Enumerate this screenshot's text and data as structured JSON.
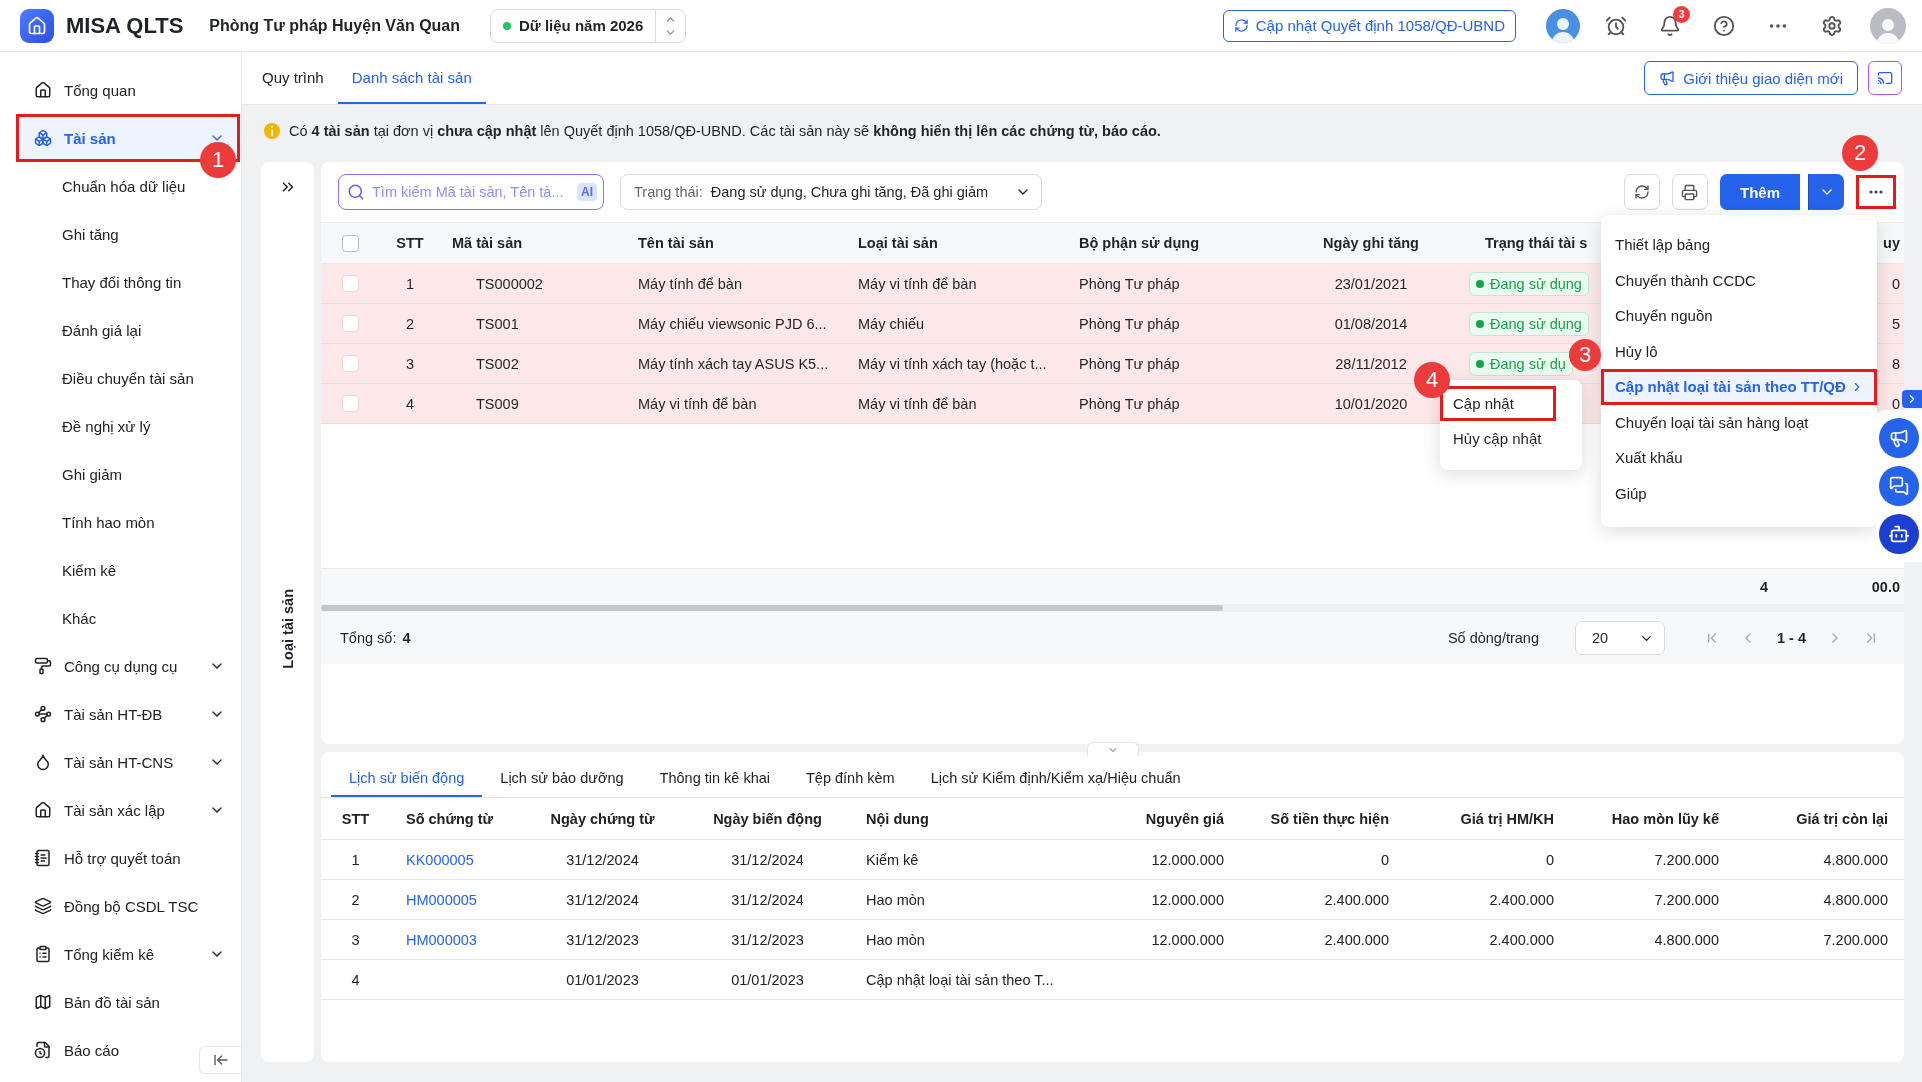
{
  "app": {
    "name": "MISA QLTS",
    "unit": "Phòng Tư pháp Huyện Văn Quan",
    "year_selector": "Dữ liệu năm 2026",
    "update_button": "Cập nhật Quyết định 1058/QĐ-UBND",
    "notification_count": "3"
  },
  "sidebar": {
    "items": [
      {
        "label": "Tổng quan",
        "selected": false,
        "has_submenu": false
      },
      {
        "label": "Tài sản",
        "selected": true,
        "has_submenu": true,
        "callout": "1",
        "children": [
          {
            "label": "Chuẩn hóa dữ liệu"
          },
          {
            "label": "Ghi tăng"
          },
          {
            "label": "Thay đổi thông tin"
          },
          {
            "label": "Đánh giá lại"
          },
          {
            "label": "Điều chuyển tài sản"
          },
          {
            "label": "Đề nghị xử lý"
          },
          {
            "label": "Ghi giảm"
          },
          {
            "label": "Tính hao mòn"
          },
          {
            "label": "Kiểm kê"
          },
          {
            "label": "Khác"
          }
        ]
      },
      {
        "label": "Công cụ dụng cụ",
        "selected": false,
        "has_submenu": true
      },
      {
        "label": "Tài sản HT-ĐB",
        "selected": false,
        "has_submenu": true
      },
      {
        "label": "Tài sản HT-CNS",
        "selected": false,
        "has_submenu": true
      },
      {
        "label": "Tài sản xác lập",
        "selected": false,
        "has_submenu": true
      },
      {
        "label": "Hỗ trợ quyết toán",
        "selected": false,
        "has_submenu": false
      },
      {
        "label": "Đồng bộ CSDL TSC",
        "selected": false,
        "has_submenu": false
      },
      {
        "label": "Tổng kiểm kê",
        "selected": false,
        "has_submenu": true
      },
      {
        "label": "Bản đồ tài sản",
        "selected": false,
        "has_submenu": false
      },
      {
        "label": "Báo cáo",
        "selected": false,
        "has_submenu": false
      }
    ]
  },
  "tabs": [
    {
      "label": "Quy trình",
      "selected": false
    },
    {
      "label": "Danh sách tài sản",
      "selected": true
    }
  ],
  "intro_button": "Giới thiệu giao diện mới",
  "notice": "Có **4 tài sản** tại đơn vị **chưa cập nhật** lên Quyết định 1058/QĐ-UBND. Các tài sản này sẽ **không hiển thị lên các chứng từ, báo cáo.**",
  "category_panel": {
    "title": "Loại tài sản"
  },
  "toolbar": {
    "search": {
      "placeholder": "Tìm kiếm Mã tài sản, Tên tà...",
      "badge": "AI"
    },
    "status_filter": {
      "label": "Trạng thái:",
      "value": "Đang sử dụng, Chưa ghi tăng, Đã ghi giảm"
    },
    "add_button": "Thêm",
    "more_button": {
      "callout": "2"
    }
  },
  "more_menu": {
    "items": [
      {
        "label": "Thiết lập bảng",
        "selected": false,
        "has_submenu": false
      },
      {
        "label": "Chuyển thành CCDC",
        "selected": false,
        "has_submenu": false
      },
      {
        "label": "Chuyển nguồn",
        "selected": false,
        "has_submenu": false
      },
      {
        "label": "Hủy lô",
        "selected": false,
        "has_submenu": false
      },
      {
        "label": "Cập nhật loại tài sản theo TT/QĐ",
        "selected": true,
        "has_submenu": true,
        "callout": "3"
      },
      {
        "label": "Chuyển loại tài sản hàng loạt",
        "selected": false,
        "has_submenu": false
      },
      {
        "label": "Xuất khẩu",
        "selected": false,
        "has_submenu": false
      },
      {
        "label": "Giúp",
        "selected": false,
        "has_submenu": false
      }
    ]
  },
  "submenu": {
    "items": [
      {
        "label": "Cập nhật",
        "callout": "4"
      },
      {
        "label": "Hủy cập nhật"
      }
    ]
  },
  "assets_table": {
    "select_all_checked": false,
    "columns": [
      "STT",
      "Mã tài sản",
      "Tên tài sản",
      "Loại tài sản",
      "Bộ phận sử dụng",
      "Ngày ghi tăng",
      "Trạng thái tài s",
      "uy"
    ],
    "rows": [
      {
        "checked": false,
        "flagged": true,
        "stt": "1",
        "code": "TS000002",
        "name": "Máy tính để bàn",
        "type": "Máy vi tính để bàn",
        "department": "Phòng Tư pháp",
        "date": "23/01/2021",
        "status": "Đang sử dụng",
        "column_9": "0"
      },
      {
        "checked": false,
        "flagged": true,
        "stt": "2",
        "code": "TS001",
        "name": "Máy chiếu viewsonic PJD 6...",
        "type": "Máy chiếu",
        "department": "Phòng Tư pháp",
        "date": "01/08/2014",
        "status": "Đang sử dụng",
        "column_9": "5"
      },
      {
        "checked": false,
        "flagged": true,
        "stt": "3",
        "code": "TS002",
        "name": "Máy tính xách tay ASUS K5...",
        "type": "Máy vi tính xách tay (hoặc t...",
        "department": "Phòng Tư pháp",
        "date": "28/11/2012",
        "status": "Đang sử dụ",
        "column_9": "8"
      },
      {
        "checked": false,
        "flagged": true,
        "stt": "4",
        "code": "TS009",
        "name": "Máy vi tính để bàn",
        "type": "Máy vi tính để bàn",
        "department": "Phòng Tư pháp",
        "date": "10/01/2020",
        "column_9": "0"
      }
    ],
    "summary": {
      "count": "4",
      "column_9": "00.0"
    }
  },
  "footer": {
    "total_label": "Tổng số:",
    "total": "4",
    "page_size_label": "Số dòng/trang",
    "page_size": "20",
    "page_range": "1 - 4"
  },
  "history": {
    "tabs": [
      {
        "label": "Lịch sử biến động",
        "selected": true
      },
      {
        "label": "Lịch sử bảo dưỡng",
        "selected": false
      },
      {
        "label": "Thông tin kê khai",
        "selected": false
      },
      {
        "label": "Tệp đính kèm",
        "selected": false
      },
      {
        "label": "Lịch sử Kiểm định/Kiểm xạ/Hiệu chuẩn",
        "selected": false
      }
    ],
    "columns": [
      "STT",
      "Số chứng từ",
      "Ngày chứng từ",
      "Ngày biến động",
      "Nội dung",
      "Nguyên giá",
      "Số tiền thực hiện",
      "Giá trị HM/KH",
      "Hao mòn lũy kế",
      "Giá trị còn lại"
    ],
    "rows": [
      [
        "1",
        "KK000005",
        "31/12/2024",
        "31/12/2024",
        "Kiểm kê",
        "12.000.000",
        "0",
        "0",
        "7.200.000",
        "4.800.000"
      ],
      [
        "2",
        "HM000005",
        "31/12/2024",
        "31/12/2024",
        "Hao mòn",
        "12.000.000",
        "2.400.000",
        "2.400.000",
        "7.200.000",
        "4.800.000"
      ],
      [
        "3",
        "HM000003",
        "31/12/2023",
        "31/12/2023",
        "Hao mòn",
        "12.000.000",
        "2.400.000",
        "2.400.000",
        "4.800.000",
        "7.200.000"
      ],
      [
        "4",
        "",
        "01/01/2023",
        "01/01/2023",
        "Cập nhật loại tài sản theo T...",
        "",
        "",
        "",
        "",
        ""
      ]
    ]
  }
}
